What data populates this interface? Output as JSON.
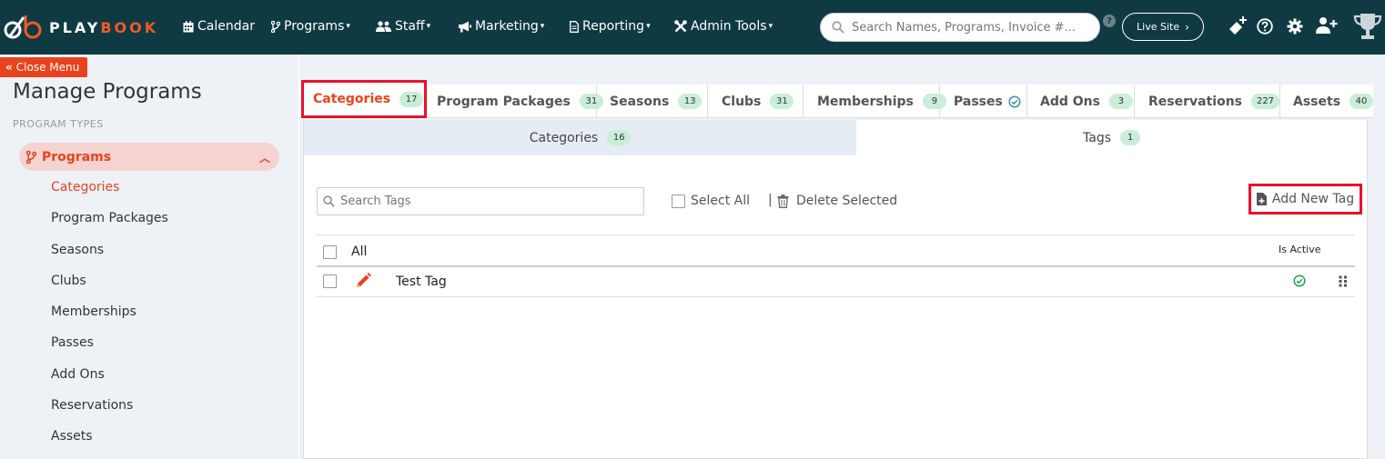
{
  "brand": {
    "play": "PLAY",
    "book": "BOOK",
    "accent": "#f15a24",
    "nav_bg": "#0f3a43"
  },
  "nav": {
    "items": [
      {
        "label": "Calendar",
        "icon": "calendar-icon",
        "dropdown": false
      },
      {
        "label": "Programs",
        "icon": "branch-icon",
        "dropdown": true
      },
      {
        "label": "Staff",
        "icon": "users-icon",
        "dropdown": true
      },
      {
        "label": "Marketing",
        "icon": "megaphone-icon",
        "dropdown": true
      },
      {
        "label": "Reporting",
        "icon": "file-icon",
        "dropdown": true
      },
      {
        "label": "Admin Tools",
        "icon": "tools-icon",
        "dropdown": true
      }
    ],
    "search_placeholder": "Search Names, Programs, Invoice #...",
    "help_glyph": "?",
    "live_site": "Live Site"
  },
  "close_menu": "Close Menu",
  "sidebar": {
    "title": "Manage Programs",
    "section": "PROGRAM TYPES",
    "group": "Programs",
    "items": [
      "Categories",
      "Program Packages",
      "Seasons",
      "Clubs",
      "Memberships",
      "Passes",
      "Add Ons",
      "Reservations",
      "Assets"
    ]
  },
  "tabs": [
    {
      "label": "Categories",
      "badge": "17"
    },
    {
      "label": "Program Packages",
      "badge": "31"
    },
    {
      "label": "Seasons",
      "badge": "13"
    },
    {
      "label": "Clubs",
      "badge": "31"
    },
    {
      "label": "Memberships",
      "badge": "9"
    },
    {
      "label": "Passes",
      "badge": ""
    },
    {
      "label": "Add Ons",
      "badge": "3"
    },
    {
      "label": "Reservations",
      "badge": "227"
    },
    {
      "label": "Assets",
      "badge": "40"
    }
  ],
  "subtabs": [
    {
      "label": "Categories",
      "badge": "16"
    },
    {
      "label": "Tags",
      "badge": "1"
    }
  ],
  "toolbar": {
    "search_placeholder": "Search Tags",
    "select_all": "Select All",
    "delete_selected": "Delete Selected",
    "add_new": "Add New Tag"
  },
  "table": {
    "header_all": "All",
    "header_active": "Is Active",
    "rows": [
      {
        "name": "Test Tag",
        "active": true
      }
    ]
  }
}
